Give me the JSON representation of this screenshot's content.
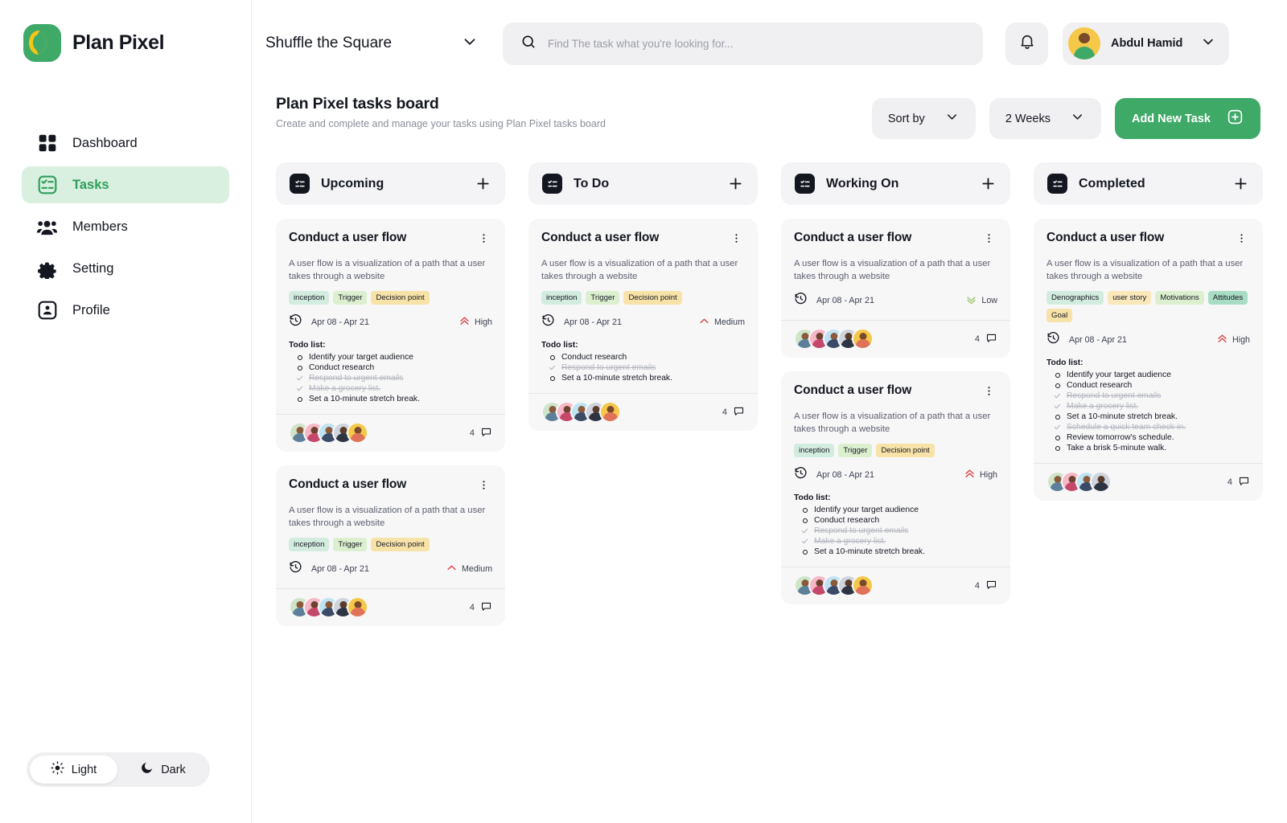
{
  "brand": {
    "name": "Plan Pixel",
    "logo_colors": {
      "bg": "#3fa968",
      "ring": "#f5c518"
    }
  },
  "sidebar": {
    "items": [
      {
        "label": "Dashboard",
        "icon": "grid-icon",
        "active": false
      },
      {
        "label": "Tasks",
        "icon": "tasks-checklist-icon",
        "active": true
      },
      {
        "label": "Members",
        "icon": "members-group-icon",
        "active": false
      },
      {
        "label": "Setting",
        "icon": "gear-icon",
        "active": false
      },
      {
        "label": "Profile",
        "icon": "profile-card-icon",
        "active": false
      }
    ],
    "theme": {
      "light_label": "Light",
      "dark_label": "Dark",
      "selected": "Light"
    }
  },
  "topbar": {
    "board_name": "Shuffle the Square",
    "search_placeholder": "Find The task what you're looking for...",
    "user_name": "Abdul Hamid"
  },
  "page": {
    "title": "Plan Pixel tasks board",
    "subtitle": "Create and complete and manage your tasks using Plan Pixel tasks board",
    "sort_label": "Sort by",
    "range_label": "2 Weeks",
    "add_task_label": "Add New Task"
  },
  "colors": {
    "accent": "#3fa968",
    "priority_high": "#d94a4a",
    "priority_medium": "#d94a4a",
    "priority_low": "#9ec96f",
    "tag_mint": "#d3ece0",
    "tag_green": "#dcf0d0",
    "tag_yellow": "#f7e2a8",
    "tag_teal": "#a8dcc4",
    "tag_cream": "#fae8bb"
  },
  "columns": [
    {
      "title": "Upcoming",
      "icon": "column-checklist-icon",
      "add_icon": "plus-icon",
      "cards": [
        {
          "title": "Conduct a user flow",
          "description": "A user flow is a visualization of a path that a user takes through a website",
          "tags": [
            {
              "label": "inception",
              "color": "#d3ece0"
            },
            {
              "label": "Trigger",
              "color": "#dcf0d0"
            },
            {
              "label": "Decision point",
              "color": "#f7e2a8"
            }
          ],
          "date": "Apr 08 - Apr 21",
          "priority": "High",
          "todo_header": "Todo list:",
          "todos": [
            {
              "text": "Identify your target audience",
              "done": false
            },
            {
              "text": "Conduct research",
              "done": false
            },
            {
              "text": "Respond to urgent emails",
              "done": true
            },
            {
              "text": "Make a grocery list.",
              "done": true
            },
            {
              "text": "Set a 10-minute stretch break.",
              "done": false
            }
          ],
          "avatar_count": 5,
          "comments": "4"
        },
        {
          "title": "Conduct a user flow",
          "description": "A user flow is a visualization of a path that a user takes through a website",
          "tags": [
            {
              "label": "inception",
              "color": "#d3ece0"
            },
            {
              "label": "Trigger",
              "color": "#dcf0d0"
            },
            {
              "label": "Decision point",
              "color": "#f7e2a8"
            }
          ],
          "date": "Apr 08 - Apr 21",
          "priority": "Medium",
          "todo_header": "",
          "todos": [],
          "avatar_count": 5,
          "comments": "4"
        }
      ]
    },
    {
      "title": "To Do",
      "icon": "column-checklist-icon",
      "add_icon": "plus-icon",
      "cards": [
        {
          "title": "Conduct a user flow",
          "description": "A user flow is a visualization of a path that a user takes through a website",
          "tags": [
            {
              "label": "inception",
              "color": "#d3ece0"
            },
            {
              "label": "Trigger",
              "color": "#dcf0d0"
            },
            {
              "label": "Decision point",
              "color": "#f7e2a8"
            }
          ],
          "date": "Apr 08 - Apr 21",
          "priority": "Medium",
          "todo_header": "Todo list:",
          "todos": [
            {
              "text": "Conduct research",
              "done": false
            },
            {
              "text": "Respond to urgent emails",
              "done": true
            },
            {
              "text": "Set a 10-minute stretch break.",
              "done": false
            }
          ],
          "avatar_count": 5,
          "comments": "4"
        }
      ]
    },
    {
      "title": "Working On",
      "icon": "column-checklist-icon",
      "add_icon": "plus-icon",
      "cards": [
        {
          "title": "Conduct a user flow",
          "description": "A user flow is a visualization of a path that a user takes through a website",
          "tags": [],
          "date": "Apr 08 - Apr 21",
          "priority": "Low",
          "todo_header": "",
          "todos": [],
          "avatar_count": 5,
          "comments": "4"
        },
        {
          "title": "Conduct a user flow",
          "description": "A user flow is a visualization of a path that a user takes through a website",
          "tags": [
            {
              "label": "inception",
              "color": "#d3ece0"
            },
            {
              "label": "Trigger",
              "color": "#dcf0d0"
            },
            {
              "label": "Decision point",
              "color": "#f7e2a8"
            }
          ],
          "date": "Apr 08 - Apr 21",
          "priority": "High",
          "todo_header": "Todo list:",
          "todos": [
            {
              "text": "Identify your target audience",
              "done": false
            },
            {
              "text": "Conduct research",
              "done": false
            },
            {
              "text": "Respond to urgent emails",
              "done": true
            },
            {
              "text": "Make a grocery list.",
              "done": true
            },
            {
              "text": "Set a 10-minute stretch break.",
              "done": false
            }
          ],
          "avatar_count": 5,
          "comments": "4"
        }
      ]
    },
    {
      "title": "Completed",
      "icon": "column-checklist-icon",
      "add_icon": "plus-icon",
      "cards": [
        {
          "title": "Conduct a user flow",
          "description": "A user flow is a visualization of a path that a user takes through a website",
          "tags": [
            {
              "label": "Denographics",
              "color": "#d3ece0"
            },
            {
              "label": "user story",
              "color": "#fae8bb"
            },
            {
              "label": "Motivations",
              "color": "#dcf0d0"
            },
            {
              "label": "Attitudes",
              "color": "#a8dcc4"
            },
            {
              "label": "Goal",
              "color": "#f7e2a8"
            }
          ],
          "date": "Apr 08 - Apr 21",
          "priority": "High",
          "todo_header": "Todo list:",
          "todos": [
            {
              "text": "Identify your target audience",
              "done": false
            },
            {
              "text": "Conduct research",
              "done": false
            },
            {
              "text": "Respond to urgent emails",
              "done": true
            },
            {
              "text": "Make a grocery list.",
              "done": true
            },
            {
              "text": "Set a 10-minute stretch break.",
              "done": false
            },
            {
              "text": "Schedule a quick team check-in.",
              "done": true
            },
            {
              "text": "Review tomorrow's schedule.",
              "done": false
            },
            {
              "text": "Take a brisk 5-minute walk.",
              "done": false
            }
          ],
          "avatar_count": 4,
          "comments": "4"
        }
      ]
    }
  ]
}
